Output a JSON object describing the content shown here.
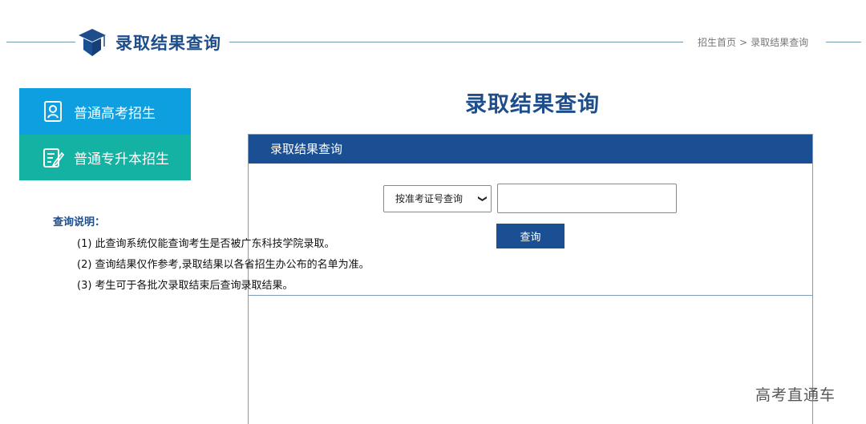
{
  "header": {
    "site_title": "录取结果查询",
    "breadcrumb": {
      "home": "招生首页",
      "separator": ">",
      "current": "录取结果查询"
    }
  },
  "sidebar": {
    "items": [
      {
        "label": "普通高考招生",
        "icon": "user-card-icon",
        "color": "#0d9fe0"
      },
      {
        "label": "普通专升本招生",
        "icon": "edit-document-icon",
        "color": "#13b2a2"
      }
    ]
  },
  "main": {
    "title": "录取结果查询",
    "panel_title": "录取结果查询",
    "form": {
      "select_value": "按准考证号查询",
      "input_value": "",
      "button_label": "查询"
    },
    "notes": {
      "title": "查询说明：",
      "lines": [
        "(1)  此查询系统仅能查询考生是否被广东科技学院录取。",
        "(2)  查询结果仅作参考,录取结果以各省招生办公布的名单为准。",
        "(3)  考生可于各批次录取结束后查询录取结果。"
      ]
    }
  },
  "watermark": "高考直通车",
  "colors": {
    "brand_blue": "#1b4f94",
    "title_blue": "#1e4d8c",
    "sidebar_blue": "#0d9fe0",
    "sidebar_green": "#13b2a2"
  }
}
